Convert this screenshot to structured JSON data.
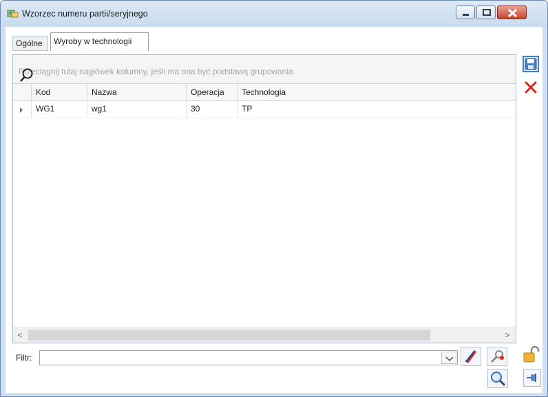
{
  "window": {
    "title": "Wzorzec numeru partii/seryjnego"
  },
  "tabs": [
    {
      "label": "Ogólne",
      "active": false
    },
    {
      "label": "Wyroby w technologii",
      "active": true
    }
  ],
  "grid": {
    "group_hint": "Przeciągnij tutaj nagłówek kolumny, jeśli ma ona być podstawą grupowania",
    "columns": [
      "Kod",
      "Nazwa",
      "Operacja",
      "Technologia"
    ],
    "rows": [
      {
        "kod": "WG1",
        "nazwa": "wg1",
        "operacja": "30",
        "technologia": "TP"
      }
    ]
  },
  "filter": {
    "label": "Filtr:",
    "value": ""
  },
  "icons": {
    "app": "app-icon",
    "search": "search-icon",
    "save": "save-icon",
    "delete": "delete-icon",
    "lock": "lock-icon",
    "pin": "pin-icon",
    "clear_filter": "clear-filter-icon",
    "filter_options": "filter-options-icon",
    "search_button": "magnifier-icon"
  },
  "colors": {
    "accent": "#3c7fd1",
    "delete": "#d92a1c",
    "titlebar": "#c9dbee"
  }
}
